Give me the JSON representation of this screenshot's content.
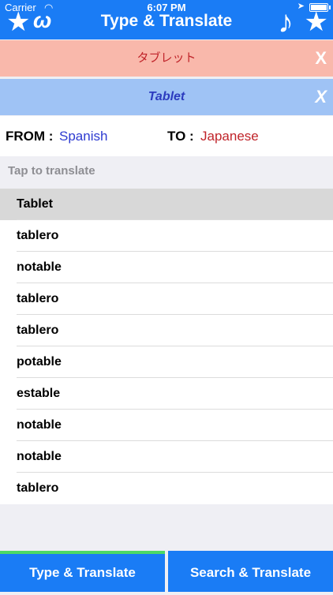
{
  "status_bar": {
    "carrier": "Carrier",
    "time": "6:07 PM"
  },
  "nav": {
    "title": "Type & Translate"
  },
  "translation": {
    "target_text": "タブレット",
    "source_text": "Tablet",
    "close_label": "X"
  },
  "languages": {
    "from_label": "FROM :",
    "from_value": "Spanish",
    "to_label": "TO :",
    "to_value": "Japanese"
  },
  "hint": "Tap to translate",
  "suggestions": [
    "Tablet",
    "tablero",
    "notable",
    "tablero",
    "tablero",
    "potable",
    "estable",
    "notable",
    "notable",
    "tablero"
  ],
  "tabs": {
    "type_translate": "Type & Translate",
    "search_translate": "Search & Translate"
  },
  "colors": {
    "accent": "#1a7cf5",
    "target_bg": "#f9b8ab",
    "source_bg": "#9fc3f5",
    "active_tab_indicator": "#4cd964"
  },
  "icons": {
    "left": [
      "star-icon",
      "app-logo-icon"
    ],
    "right": [
      "music-note-icon",
      "star-icon"
    ]
  }
}
